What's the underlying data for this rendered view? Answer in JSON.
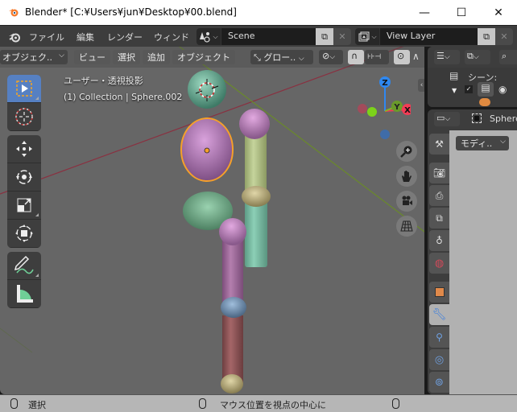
{
  "window": {
    "title": "Blender* [C:¥Users¥jun¥Desktop¥00.blend]",
    "controls": {
      "minimize": "—",
      "maximize": "☐",
      "close": "✕"
    }
  },
  "menubar": {
    "items": [
      "ファイル",
      "編集",
      "レンダー",
      "ウィンド"
    ],
    "scene": {
      "icon": "scene-icon",
      "value": "Scene"
    },
    "view_layer": {
      "icon": "view-layer-icon",
      "value": "View Layer"
    }
  },
  "viewport": {
    "header": {
      "mode": "オブジェク..",
      "menus": [
        "ビュー",
        "選択",
        "追加",
        "オブジェクト"
      ],
      "transform_orientation": "グロー..",
      "icons": [
        "transform-orientation-icon",
        "pivot-icon",
        "snap-icon",
        "snap-increment-icon",
        "proportional-edit-icon",
        "proportional-falloff-icon"
      ]
    },
    "overlay": {
      "view_name": "ユーザー・透視投影",
      "collection_info": "(1) Collection | Sphere.002"
    },
    "tools": [
      "select-box-tool",
      "cursor-tool",
      "move-tool",
      "rotate-tool",
      "scale-tool",
      "transform-tool",
      "annotate-tool",
      "measure-tool"
    ],
    "gizmo": {
      "x_label": "X",
      "y_label": "Y",
      "z_label": "Z",
      "x_color": "#f33c55",
      "y_color": "#85b822",
      "z_color": "#2f88f0"
    },
    "nav_buttons": [
      "zoom-icon",
      "pan-hand-icon",
      "camera-icon",
      "ortho-grid-icon"
    ],
    "objects": [
      {
        "name": "head-sphere",
        "color": "#6ab397"
      },
      {
        "name": "selected-ellipsoid",
        "color": "#b27cb8",
        "selected": true
      },
      {
        "name": "green-ellipsoid",
        "color": "#6aa884"
      },
      {
        "name": "right-upper-joint",
        "color": "#c588c8"
      },
      {
        "name": "right-upper-cylinder",
        "color": "#b8c78f"
      },
      {
        "name": "right-mid-joint",
        "color": "#c2b58a"
      },
      {
        "name": "right-lower-cylinder",
        "color": "#7cbfa8"
      },
      {
        "name": "left-top-joint",
        "color": "#c588c8"
      },
      {
        "name": "left-upper-cylinder",
        "color": "#a874a4"
      },
      {
        "name": "left-mid-joint",
        "color": "#6f8fb0"
      },
      {
        "name": "left-lower-cylinder",
        "color": "#9a5e60"
      },
      {
        "name": "left-bottom-joint",
        "color": "#b4a878"
      }
    ]
  },
  "outliner": {
    "scene_label": "シーン:",
    "checkbox_checked": true
  },
  "properties": {
    "object_name": "Sphere",
    "panel_dropdown": "モディ..",
    "tabs": [
      "tool",
      "render",
      "output",
      "view-layer",
      "scene",
      "world",
      "object",
      "modifiers",
      "particles",
      "physics",
      "constraints"
    ],
    "active_tab": "modifiers"
  },
  "statusbar": {
    "left": "選択",
    "middle": "マウス位置を視点の中心に",
    "right": ""
  }
}
